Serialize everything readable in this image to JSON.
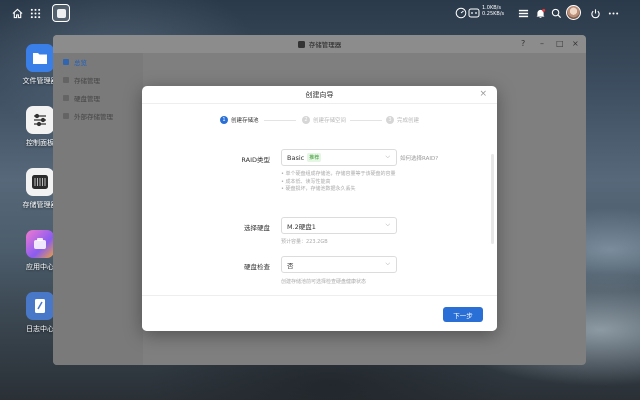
{
  "topbar": {
    "net_up": "1.0KB/s",
    "net_down": "0.25KB/s"
  },
  "desktop": {
    "icons": [
      {
        "label": "文件管理器",
        "color": "#3a7ee8"
      },
      {
        "label": "控制面板",
        "color": "#f2f2f2"
      },
      {
        "label": "存储管理器",
        "color": "#2b2b2b"
      },
      {
        "label": "应用中心",
        "color": "#9b59f0"
      },
      {
        "label": "日志中心",
        "color": "#4a78c9"
      }
    ]
  },
  "window": {
    "title": "存储管理器",
    "help": "?",
    "sidebar": [
      {
        "label": "总览"
      },
      {
        "label": "存储管理"
      },
      {
        "label": "硬盘管理"
      },
      {
        "label": "外部存储管理"
      }
    ]
  },
  "modal": {
    "title": "创建向导",
    "close": "×",
    "steps": [
      {
        "num": "1",
        "label": "创建存储池"
      },
      {
        "num": "2",
        "label": "创建存储空间"
      },
      {
        "num": "3",
        "label": "完成创建"
      }
    ],
    "raid": {
      "label": "RAID类型",
      "value": "Basic",
      "tag": "推荐",
      "help": "如何选择RAID?",
      "bullets": [
        "单个硬盘组成存储池，存储容量等于该硬盘的容量",
        "成本低、读写性能高",
        "硬盘损坏，存储池数据永久丢失"
      ]
    },
    "disk": {
      "label": "选择硬盘",
      "value": "M.2硬盘1",
      "capacity_hint": "预计容量：223.2GB"
    },
    "check": {
      "label": "硬盘检查",
      "value": "否",
      "hint": "创建存储池前可选择检查硬盘健康状态"
    },
    "next_button": "下一步"
  }
}
